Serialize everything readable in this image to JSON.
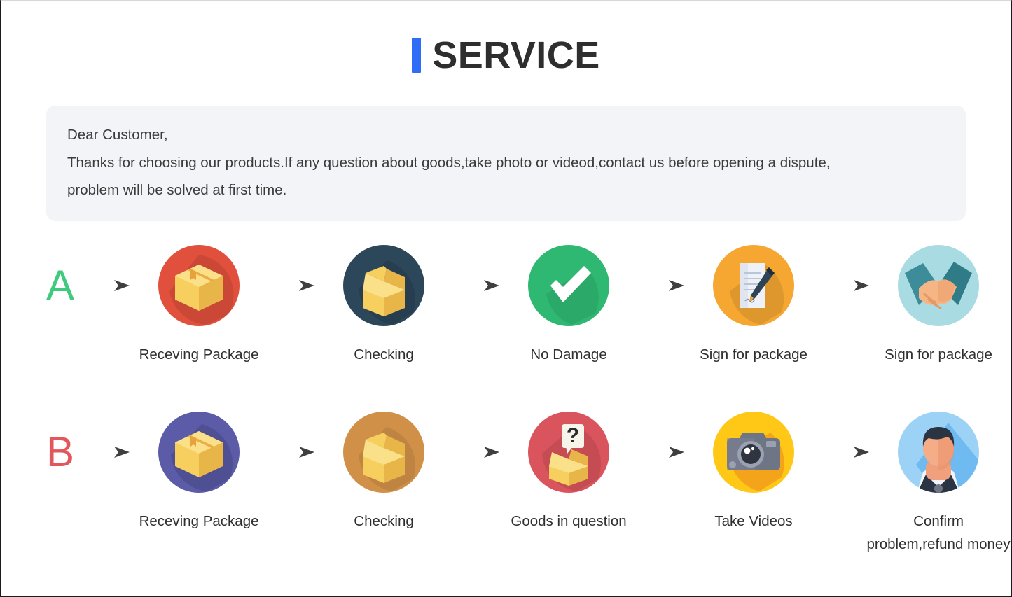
{
  "header": {
    "accent_color": "#2f6df6",
    "title": "SERVICE"
  },
  "notice": {
    "line1": "Dear Customer,",
    "line2": "Thanks for choosing our products.If any question about goods,take photo or videod,contact us before opening a dispute,",
    "line3": "problem will be solved at first time.",
    "background_color": "#f2f4f7"
  },
  "flows": [
    {
      "letter": "A",
      "letter_color": "#3fcb7d",
      "steps": [
        {
          "icon": "package-box-icon",
          "label": "Receving Package",
          "circle_color": "#e0503c"
        },
        {
          "icon": "open-box-icon",
          "label": "Checking",
          "circle_color": "#2c475a"
        },
        {
          "icon": "checkmark-icon",
          "label": "No Damage",
          "circle_color": "#2eb872"
        },
        {
          "icon": "signature-document-icon",
          "label": "Sign for package",
          "circle_color": "#f5a732"
        },
        {
          "icon": "handshake-icon",
          "label": "Sign for package",
          "circle_color": "#a8dce2"
        }
      ]
    },
    {
      "letter": "B",
      "letter_color": "#e2575c",
      "steps": [
        {
          "icon": "package-box-icon",
          "label": "Receving Package",
          "circle_color": "#5b5ba8"
        },
        {
          "icon": "open-box-icon",
          "label": "Checking",
          "circle_color": "#d09048"
        },
        {
          "icon": "question-box-icon",
          "label": "Goods in question",
          "circle_color": "#d9545c"
        },
        {
          "icon": "camera-icon",
          "label": "Take Videos",
          "circle_color": "#ffc817"
        },
        {
          "icon": "customer-support-icon",
          "label": "Confirm problem,refund money",
          "circle_color": "#9dd2f7"
        }
      ]
    }
  ],
  "arrow": {
    "name": "right-arrow-icon",
    "color": "#4a4a4a"
  }
}
